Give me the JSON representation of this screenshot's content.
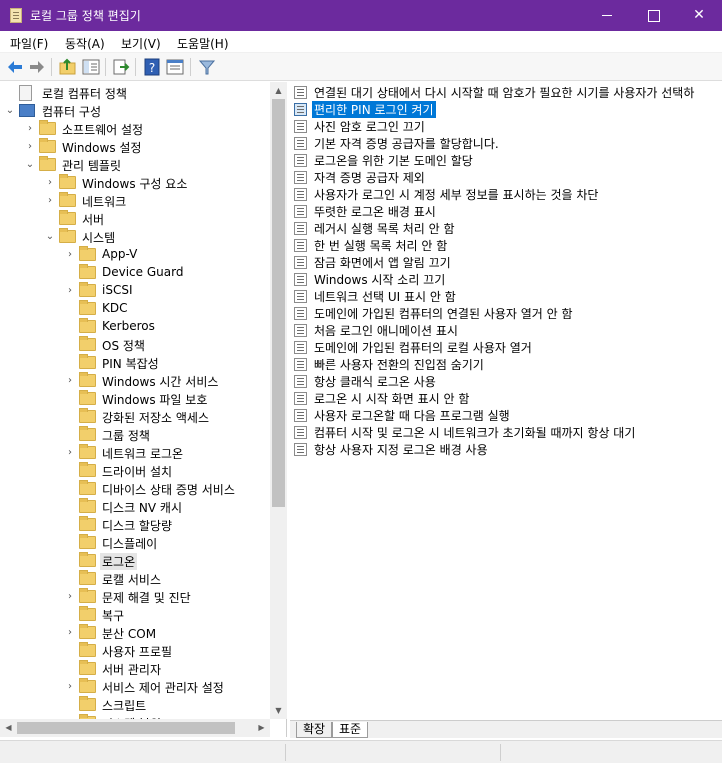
{
  "window": {
    "title": "로컬 그룹 정책 편집기",
    "accent": "#6c2a9e",
    "controls": {
      "minimize": "minimize-icon",
      "maximize": "maximize-icon",
      "close": "✕"
    }
  },
  "menu": [
    "파일(F)",
    "동작(A)",
    "보기(V)",
    "도움말(H)"
  ],
  "toolbar": {
    "buttons": [
      "back-arrow-icon",
      "forward-arrow-icon",
      "up-folder-icon",
      "show-hide-tree-icon",
      "export-list-icon",
      "help-icon",
      "properties-icon",
      "filter-icon"
    ]
  },
  "tree": [
    {
      "label": "로컬 컴퓨터 정책",
      "chev": "",
      "icon": "doc"
    },
    {
      "label": "컴퓨터 구성",
      "chev": "⌄",
      "icon": "pc"
    },
    {
      "label": "소프트웨어 설정",
      "chev": "›",
      "icon": "folder"
    },
    {
      "label": "Windows 설정",
      "chev": "›",
      "icon": "folder"
    },
    {
      "label": "관리 템플릿",
      "chev": "⌄",
      "icon": "folder"
    },
    {
      "label": "Windows 구성 요소",
      "chev": "›",
      "icon": "folder"
    },
    {
      "label": "네트워크",
      "chev": "›",
      "icon": "folder"
    },
    {
      "label": "서버",
      "chev": "",
      "icon": "folder"
    },
    {
      "label": "시스템",
      "chev": "⌄",
      "icon": "folder"
    },
    {
      "label": "App-V",
      "chev": "›",
      "icon": "folder"
    },
    {
      "label": "Device Guard",
      "chev": "",
      "icon": "folder"
    },
    {
      "label": "iSCSI",
      "chev": "›",
      "icon": "folder"
    },
    {
      "label": "KDC",
      "chev": "",
      "icon": "folder"
    },
    {
      "label": "Kerberos",
      "chev": "",
      "icon": "folder"
    },
    {
      "label": "OS 정책",
      "chev": "",
      "icon": "folder"
    },
    {
      "label": "PIN 복잡성",
      "chev": "",
      "icon": "folder"
    },
    {
      "label": "Windows 시간 서비스",
      "chev": "›",
      "icon": "folder"
    },
    {
      "label": "Windows 파일 보호",
      "chev": "",
      "icon": "folder"
    },
    {
      "label": "강화된 저장소 액세스",
      "chev": "",
      "icon": "folder"
    },
    {
      "label": "그룹 정책",
      "chev": "",
      "icon": "folder"
    },
    {
      "label": "네트워크 로그온",
      "chev": "›",
      "icon": "folder"
    },
    {
      "label": "드라이버 설치",
      "chev": "",
      "icon": "folder"
    },
    {
      "label": "디바이스 상태 증명 서비스",
      "chev": "",
      "icon": "folder"
    },
    {
      "label": "디스크 NV 캐시",
      "chev": "",
      "icon": "folder"
    },
    {
      "label": "디스크 할당량",
      "chev": "",
      "icon": "folder"
    },
    {
      "label": "디스플레이",
      "chev": "",
      "icon": "folder"
    },
    {
      "label": "로그온",
      "chev": "",
      "icon": "folder",
      "selected": true
    },
    {
      "label": "로캘 서비스",
      "chev": "",
      "icon": "folder"
    },
    {
      "label": "문제 해결 및 진단",
      "chev": "›",
      "icon": "folder"
    },
    {
      "label": "복구",
      "chev": "",
      "icon": "folder"
    },
    {
      "label": "분산 COM",
      "chev": "›",
      "icon": "folder"
    },
    {
      "label": "사용자 프로필",
      "chev": "",
      "icon": "folder"
    },
    {
      "label": "서버 관리자",
      "chev": "",
      "icon": "folder"
    },
    {
      "label": "서비스 제어 관리자 설정",
      "chev": "›",
      "icon": "folder"
    },
    {
      "label": "스크립트",
      "chev": "",
      "icon": "folder"
    },
    {
      "label": "시스템 복원",
      "chev": "",
      "icon": "folder"
    }
  ],
  "policies": [
    "연결된 대기 상태에서 다시 시작할 때 암호가 필요한 시기를 사용자가 선택하",
    "편리한 PIN 로그인 켜기",
    "사진 암호 로그인 끄기",
    "기본 자격 증명 공급자를 할당합니다.",
    "로그온을 위한 기본 도메인 할당",
    "자격 증명 공급자 제외",
    "사용자가 로그인 시 계정 세부 정보를 표시하는 것을 차단",
    "뚜렷한 로그온 배경 표시",
    "레거시 실행 목록 처리 안 함",
    "한 번 실행 목록 처리 안 함",
    "잠금 화면에서 앱 알림 끄기",
    "Windows 시작 소리 끄기",
    "네트워크 선택 UI 표시 안 함",
    "도메인에 가입된 컴퓨터의 연결된 사용자 열거 안 함",
    "처음 로그인 애니메이션 표시",
    "도메인에 가입된 컴퓨터의 로컬 사용자 열거",
    "빠른 사용자 전환의 진입점 숨기기",
    "항상 클래식 로그온 사용",
    "로그온 시 시작 화면 표시 안 함",
    "사용자 로그온할 때 다음 프로그램 실행",
    "컴퓨터 시작 및 로그온 시 네트워크가 초기화될 때까지 항상 대기",
    "항상 사용자 지정 로그온 배경 사용"
  ],
  "selected_policy_index": 1,
  "tabs": [
    "확장",
    "표준"
  ],
  "active_tab": "표준"
}
